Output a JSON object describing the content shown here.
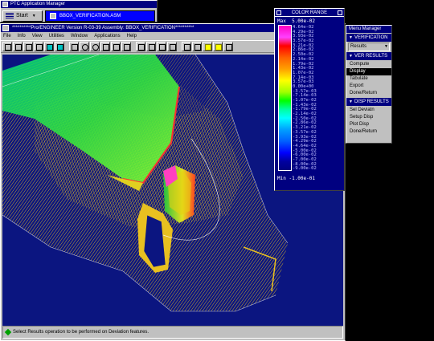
{
  "app_manager": {
    "title": "PTC Application Manager",
    "start_label": "Start",
    "task_label": "BBOX_VERIFICATION.ASM"
  },
  "proe_window": {
    "title": "**********Pro/ENGINEER Version R-03-39 Assembly: BBOX_VERIFICATION**********",
    "menus": [
      "File",
      "Info",
      "View",
      "Utilities",
      "Window",
      "Applications",
      "Help"
    ],
    "message": "Select Results operation to be performed on Deviation features."
  },
  "color_range": {
    "title": "COLOR RANGE",
    "max_label": "Max",
    "max_value": "5.00e-02",
    "min_label": "Min",
    "min_value": "-1.00e-01",
    "tick_values": [
      "4.64e-02",
      "4.29e-02",
      "3.93e-02",
      "3.57e-02",
      "3.21e-02",
      "2.86e-02",
      "2.50e-02",
      "2.14e-02",
      "1.79e-02",
      "1.43e-02",
      "1.07e-02",
      "7.14e-03",
      "3.57e-03",
      "0.00e+00",
      "-3.57e-03",
      "-7.14e-03",
      "-1.07e-02",
      "-1.43e-02",
      "-1.79e-02",
      "-2.14e-02",
      "-2.50e-02",
      "-2.86e-02",
      "-3.21e-02",
      "-3.57e-02",
      "-3.93e-02",
      "-4.29e-02",
      "-4.64e-02",
      "-5.00e-02",
      "-6.00e-02",
      "-7.00e-02",
      "-8.00e-02",
      "-9.00e-02"
    ]
  },
  "menu_manager": {
    "title": "Menu Manager",
    "verification_header": "VERIFICATION",
    "results_select": "Results",
    "ver_results_header": "VER RESULTS",
    "ver_results_items": [
      "Compute",
      "Display",
      "Tabulate",
      "Export",
      "Done/Return"
    ],
    "selected_item": "Display",
    "disp_results_header": "DISP RESULTS",
    "disp_results_items": [
      "Sel Deviatn",
      "Setup Disp",
      "Plot Disp",
      "Done/Return"
    ]
  },
  "colors": {
    "viewport_bg": "#0b1580",
    "wireframe": "#e8c020",
    "titlebar": "#000080"
  }
}
